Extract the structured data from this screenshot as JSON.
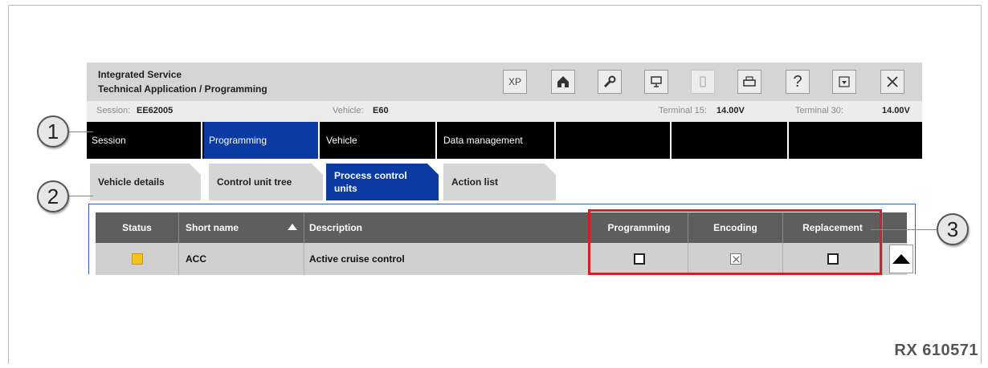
{
  "window": {
    "title_line1": "Integrated Service",
    "title_line2": "Technical Application / Programming",
    "toolbar": [
      {
        "name": "xp-button",
        "label": "XP"
      },
      {
        "name": "home-icon",
        "label": "⌂"
      },
      {
        "name": "wrench-icon",
        "label": "🔧"
      },
      {
        "name": "diagnosis-icon",
        "label": "⚇"
      },
      {
        "name": "battery-icon",
        "label": "▯"
      },
      {
        "name": "print-icon",
        "label": "⎙"
      },
      {
        "name": "help-icon",
        "label": "?"
      },
      {
        "name": "minimize-icon",
        "label": "▾"
      },
      {
        "name": "close-icon",
        "label": "✕"
      }
    ]
  },
  "session_bar": {
    "session_label": "Session:",
    "session_value": "EE62005",
    "vehicle_label": "Vehicle:",
    "vehicle_value": "E60",
    "t15_label": "Terminal 15:",
    "t15_value": "14.00V",
    "t30_label": "Terminal 30:",
    "t30_value": "14.00V"
  },
  "main_nav": [
    {
      "label": "Session"
    },
    {
      "label": "Programming"
    },
    {
      "label": "Vehicle"
    },
    {
      "label": "Data management"
    },
    {
      "label": ""
    },
    {
      "label": ""
    },
    {
      "label": ""
    }
  ],
  "sub_nav": [
    {
      "label": "Vehicle details"
    },
    {
      "label": "Control unit tree"
    },
    {
      "label": "Process control units"
    },
    {
      "label": "Action list"
    }
  ],
  "table": {
    "headers": {
      "status": "Status",
      "short_name": "Short name",
      "description": "Description",
      "programming": "Programming",
      "encoding": "Encoding",
      "replacement": "Replacement"
    },
    "rows": [
      {
        "status_color": "#f3c21b",
        "short_name": "ACC",
        "description": "Active cruise control",
        "programming": "unchecked",
        "encoding": "crossed",
        "replacement": "unchecked"
      }
    ]
  },
  "callouts": [
    "1",
    "2",
    "3"
  ],
  "reference": "RX 610571",
  "colors": {
    "accent": "#0b3aa3",
    "highlight": "#d2202a"
  }
}
